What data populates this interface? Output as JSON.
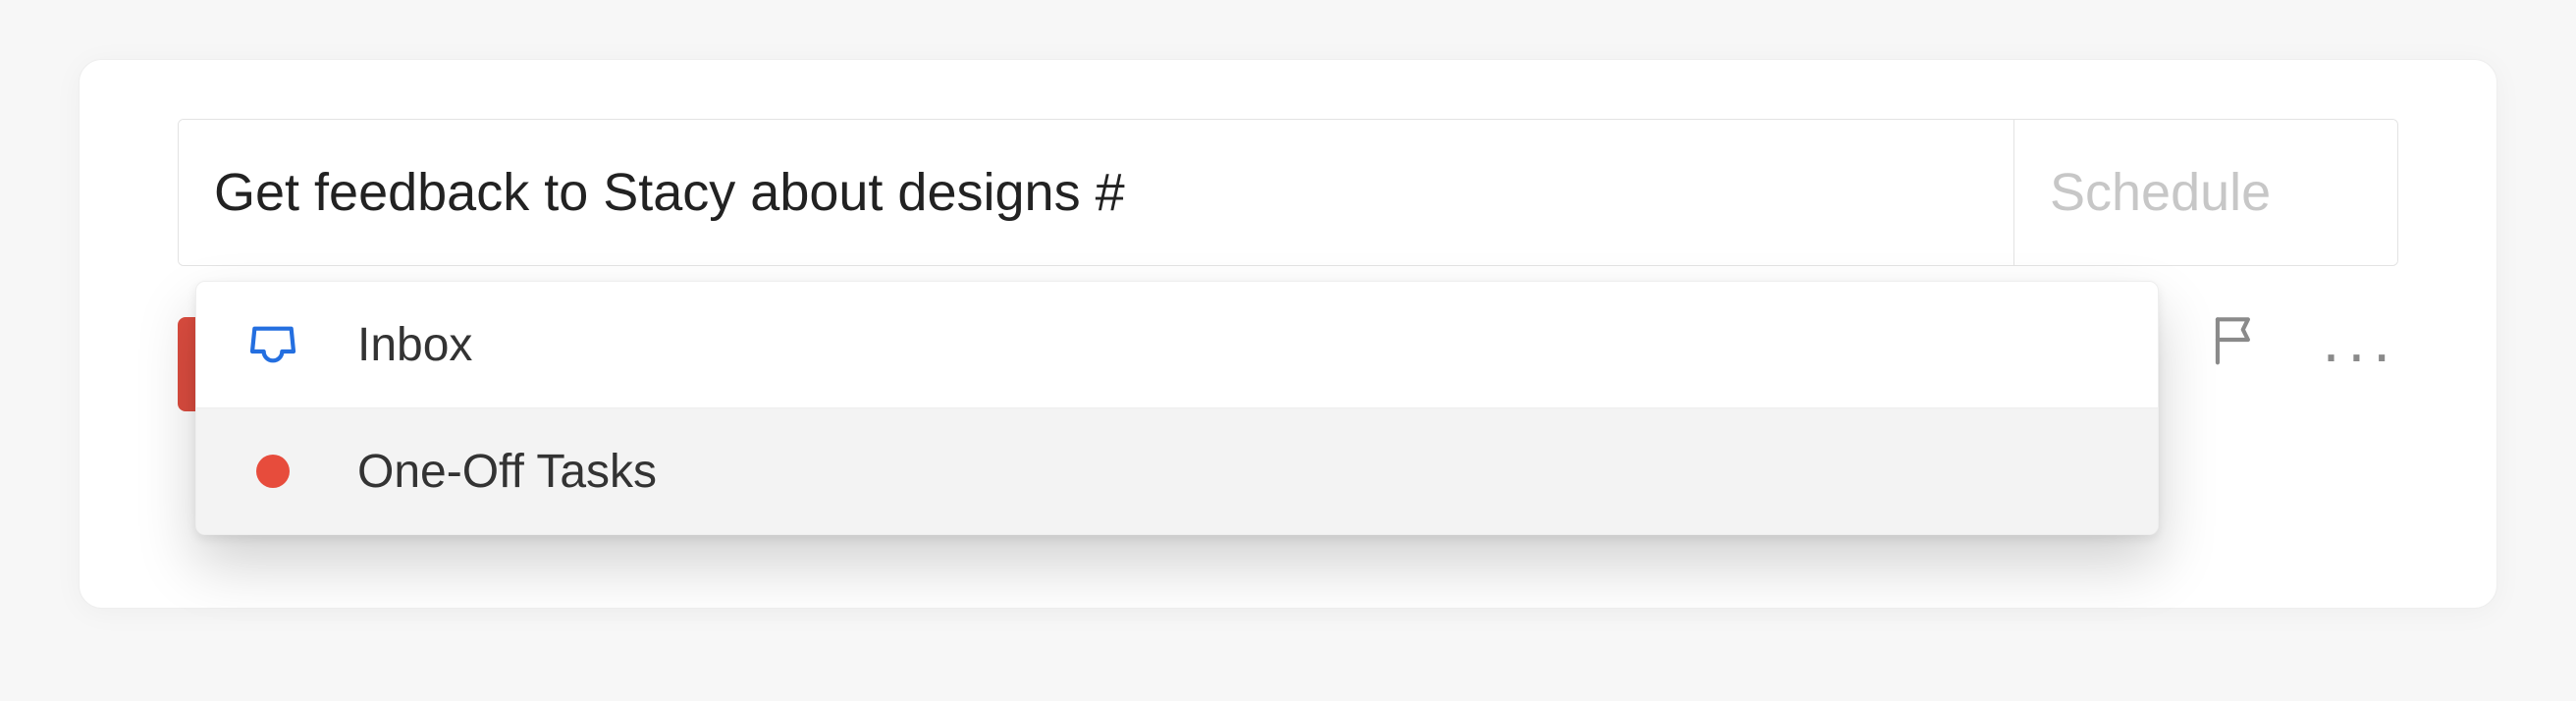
{
  "task": {
    "input_text": "Get feedback to Stacy about designs #",
    "schedule_label": "Schedule"
  },
  "project_suggestions": [
    {
      "icon": "inbox",
      "label": "Inbox",
      "highlighted": false
    },
    {
      "icon": "red-dot",
      "label": "One-Off Tasks",
      "highlighted": true
    }
  ],
  "toolbar": {
    "tag_icon": "tag",
    "reminder_icon": "alarm",
    "flag_icon": "flag",
    "more_icon": "..."
  },
  "colors": {
    "red": "#db4c3f",
    "muted": "#8a8a8a",
    "placeholder": "#c7c7c7",
    "inbox_stroke": "#246fe0"
  }
}
